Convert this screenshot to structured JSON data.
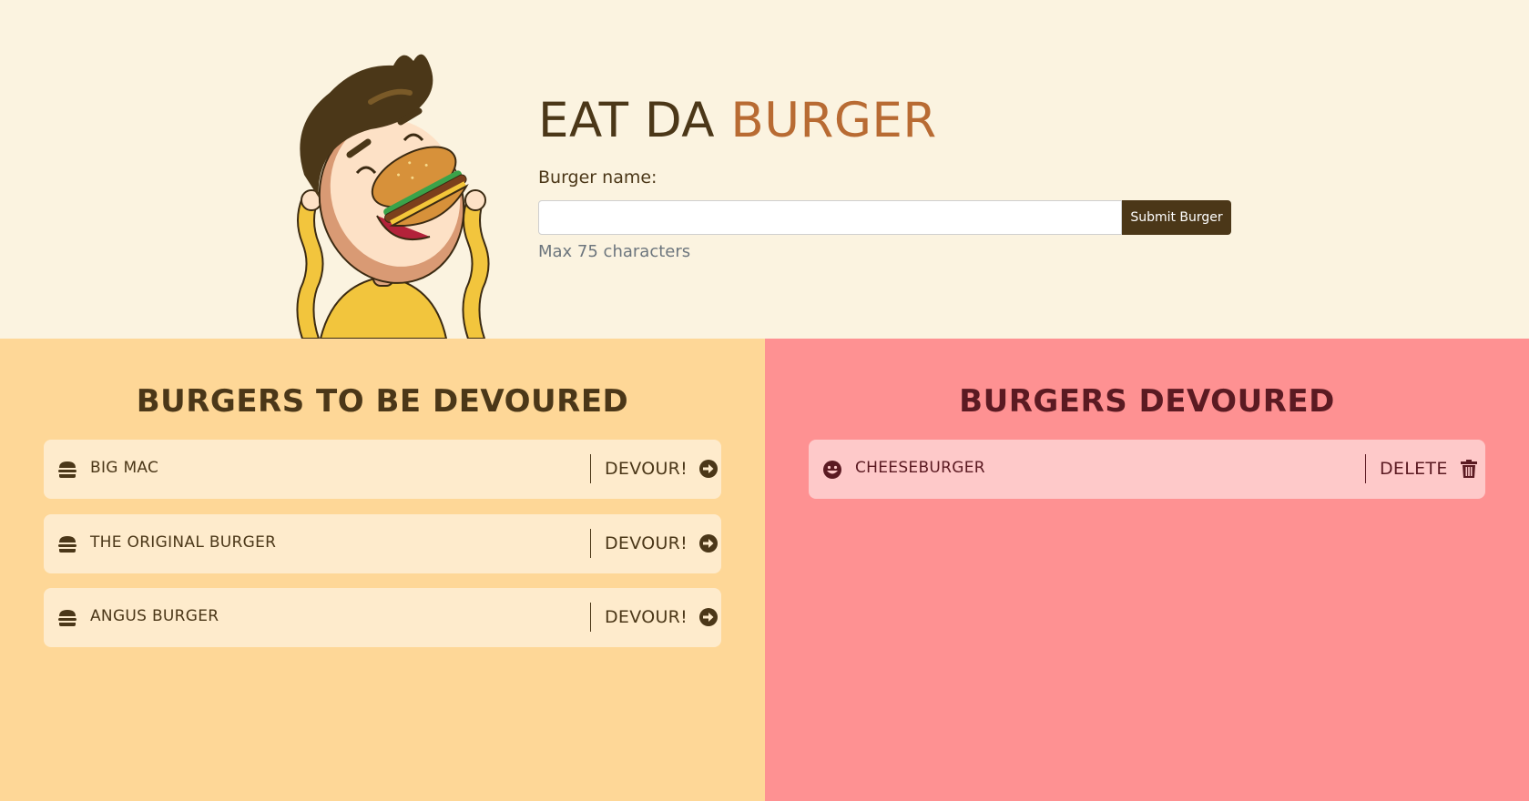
{
  "header": {
    "title_main": "EAT DA ",
    "title_accent": "BURGER",
    "burger_name_label": "Burger name:",
    "input_value": "",
    "submit_label": "Submit Burger",
    "help_text": "Max 75 characters"
  },
  "to_devour": {
    "title": "BURGERS TO BE DEVOURED",
    "action_label": "DEVOUR!",
    "items": [
      {
        "name": "BIG MAC"
      },
      {
        "name": "THE ORIGINAL BURGER"
      },
      {
        "name": "ANGUS BURGER"
      }
    ]
  },
  "devoured": {
    "title": "BURGERS DEVOURED",
    "action_label": "DELETE",
    "items": [
      {
        "name": "CHEESEBURGER"
      }
    ]
  },
  "icons": {
    "hero": "burger-eating-mascot",
    "pending_item": "hamburger-icon",
    "pending_action": "arrow-circle-right-icon",
    "devoured_item": "grin-icon",
    "devoured_action": "trash-icon"
  },
  "colors": {
    "header_bg": "#fbf3e0",
    "left_bg": "#fed797",
    "right_bg": "#fe9192",
    "dark_brown": "#4b3718",
    "accent": "#b86b33",
    "maroon": "#5b1a22"
  }
}
